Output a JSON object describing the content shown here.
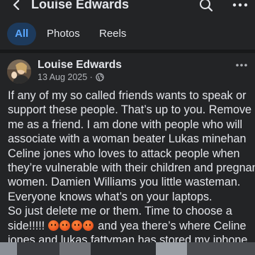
{
  "header": {
    "title": "Louise Edwards",
    "back_icon": "arrow-left-icon",
    "search_icon": "search-icon",
    "menu_icon": "more-dots-icon"
  },
  "tabs": [
    {
      "label": "All",
      "active": true
    },
    {
      "label": "Photos",
      "active": false
    },
    {
      "label": "Reels",
      "active": false
    }
  ],
  "post": {
    "author": "Louise Edwards",
    "date": "13 Aug 2025 · ",
    "audience_icon": "globe-icon",
    "more_icon": "more-dots-icon",
    "lines": [
      "If any of my so called friends wants to speak or",
      "support these people.  That’s up to you.   Remove",
      "me as a friend.   I am done with people who will",
      "associate with a woman beater Lukas minehan",
      "Celine jones who loves to attack people when",
      "they’re vulnerable with their children and pregnant",
      "women.   Damien Williams you little wasteman.",
      "Everyone knows what’s on your laptops.",
      "So just delete me or them.   Time to choose a"
    ],
    "line_10_before": "side!!!!! ",
    "emoji_count": 4,
    "line_10_after": " and yea there’s where Celine",
    "line_11": "jones and lukas fattyman has stored my iphone."
  },
  "colors": {
    "background": "#232426",
    "text": "#e4e6eb",
    "muted": "#b0b3b8",
    "active_tab_bg": "#1d3a5c",
    "active_tab_text": "#5aa7ff"
  }
}
